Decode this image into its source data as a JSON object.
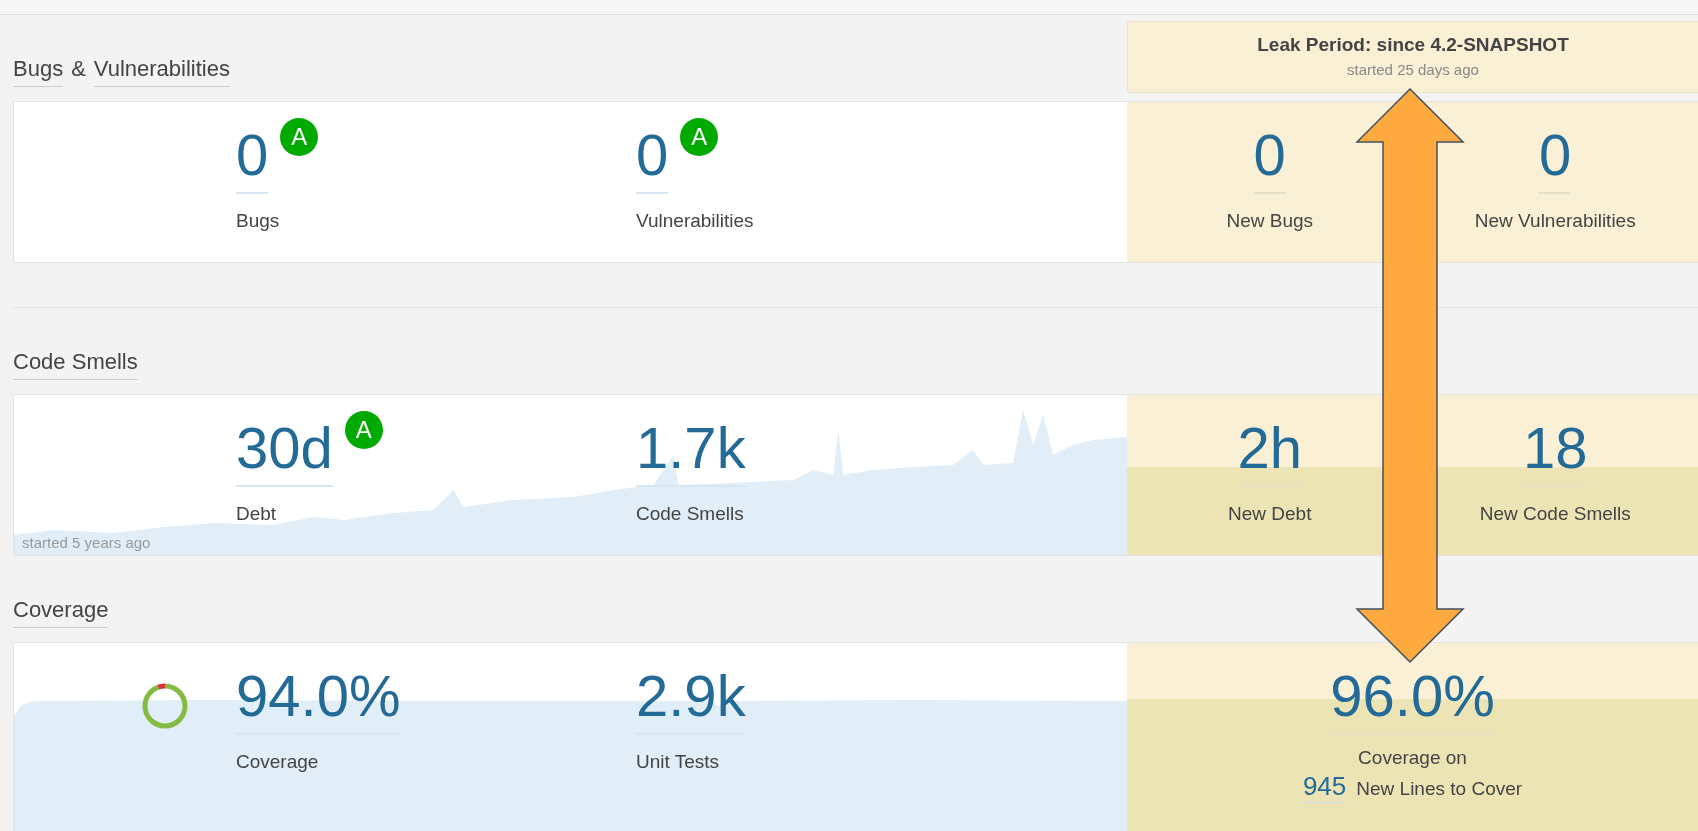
{
  "leak_period": {
    "title": "Leak Period: since 4.2-SNAPSHOT",
    "subtitle": "started 25 days ago"
  },
  "sections": [
    {
      "title": [
        {
          "text": "Bugs",
          "link": true
        },
        {
          "text": "&",
          "link": false
        },
        {
          "text": "Vulnerabilities",
          "link": true
        }
      ],
      "history": false,
      "metrics": [
        {
          "kind": "value",
          "value": "0",
          "label": "Bugs",
          "rating": "A"
        },
        {
          "kind": "value",
          "value": "0",
          "label": "Vulnerabilities",
          "rating": "A"
        }
      ],
      "leak_metrics": [
        {
          "kind": "value",
          "value": "0",
          "label": "New Bugs"
        },
        {
          "kind": "value",
          "value": "0",
          "label": "New Vulnerabilities"
        }
      ]
    },
    {
      "title": [
        {
          "text": "Code Smells",
          "link": true
        }
      ],
      "history": true,
      "history_note": "started 5 years ago",
      "metrics": [
        {
          "kind": "value",
          "value": "30d",
          "label": "Debt",
          "rating": "A"
        },
        {
          "kind": "value",
          "value": "1.7k",
          "label": "Code Smells"
        }
      ],
      "leak_metrics": [
        {
          "kind": "value",
          "value": "2h",
          "label": "New Debt"
        },
        {
          "kind": "value",
          "value": "18",
          "label": "New Code Smells"
        }
      ]
    },
    {
      "title": [
        {
          "text": "Coverage",
          "link": true
        }
      ],
      "history": true,
      "metrics": [
        {
          "kind": "donut",
          "value": "94.0%",
          "label": "Coverage"
        },
        {
          "kind": "value",
          "value": "2.9k",
          "label": "Unit Tests"
        }
      ],
      "leak_metrics": [
        {
          "kind": "coverage",
          "value": "96.0%",
          "label": "Coverage on",
          "lines": "945",
          "lines_label": "New Lines to Cover"
        }
      ]
    }
  ]
}
